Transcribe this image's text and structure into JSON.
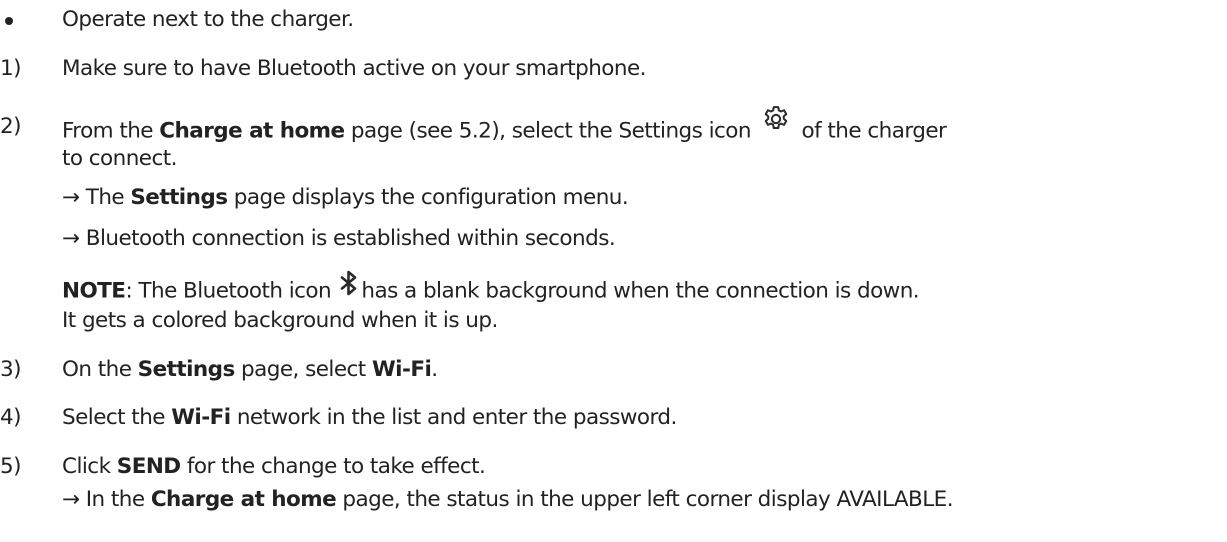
{
  "bullet": {
    "text": "Operate next to the charger."
  },
  "steps": [
    {
      "marker": "1)",
      "text": "Make sure to have Bluetooth active on your smartphone."
    },
    {
      "marker": "2)",
      "part1": "From the ",
      "bold1": "Charge at home",
      "part2": " page (see 5.2), select the Settings icon ",
      "part3": " of the charger",
      "cont": "to connect.",
      "result1_pre": "→ The ",
      "result1_bold": "Settings",
      "result1_post": " page displays the configuration menu.",
      "result2": "→ Bluetooth connection is established within seconds.",
      "note_label": "NOTE",
      "note_part1": ": The Bluetooth icon ",
      "note_part2": "has a blank background when the connection is down.",
      "note_line2": "It gets a colored background when it is up."
    },
    {
      "marker": "3)",
      "part1": "On the ",
      "bold1": "Settings",
      "part2": " page, select ",
      "bold2": "Wi-Fi",
      "part3": "."
    },
    {
      "marker": "4)",
      "part1": "Select the ",
      "bold1": "Wi-Fi",
      "part2": " network in the list and enter the password."
    },
    {
      "marker": "5)",
      "part1": "Click ",
      "bold1": "SEND",
      "part2": " for the change to take effect.",
      "result_pre": "→ In the ",
      "result_bold": "Charge at home",
      "result_post": " page, the status in the upper left corner display AVAILABLE."
    }
  ]
}
